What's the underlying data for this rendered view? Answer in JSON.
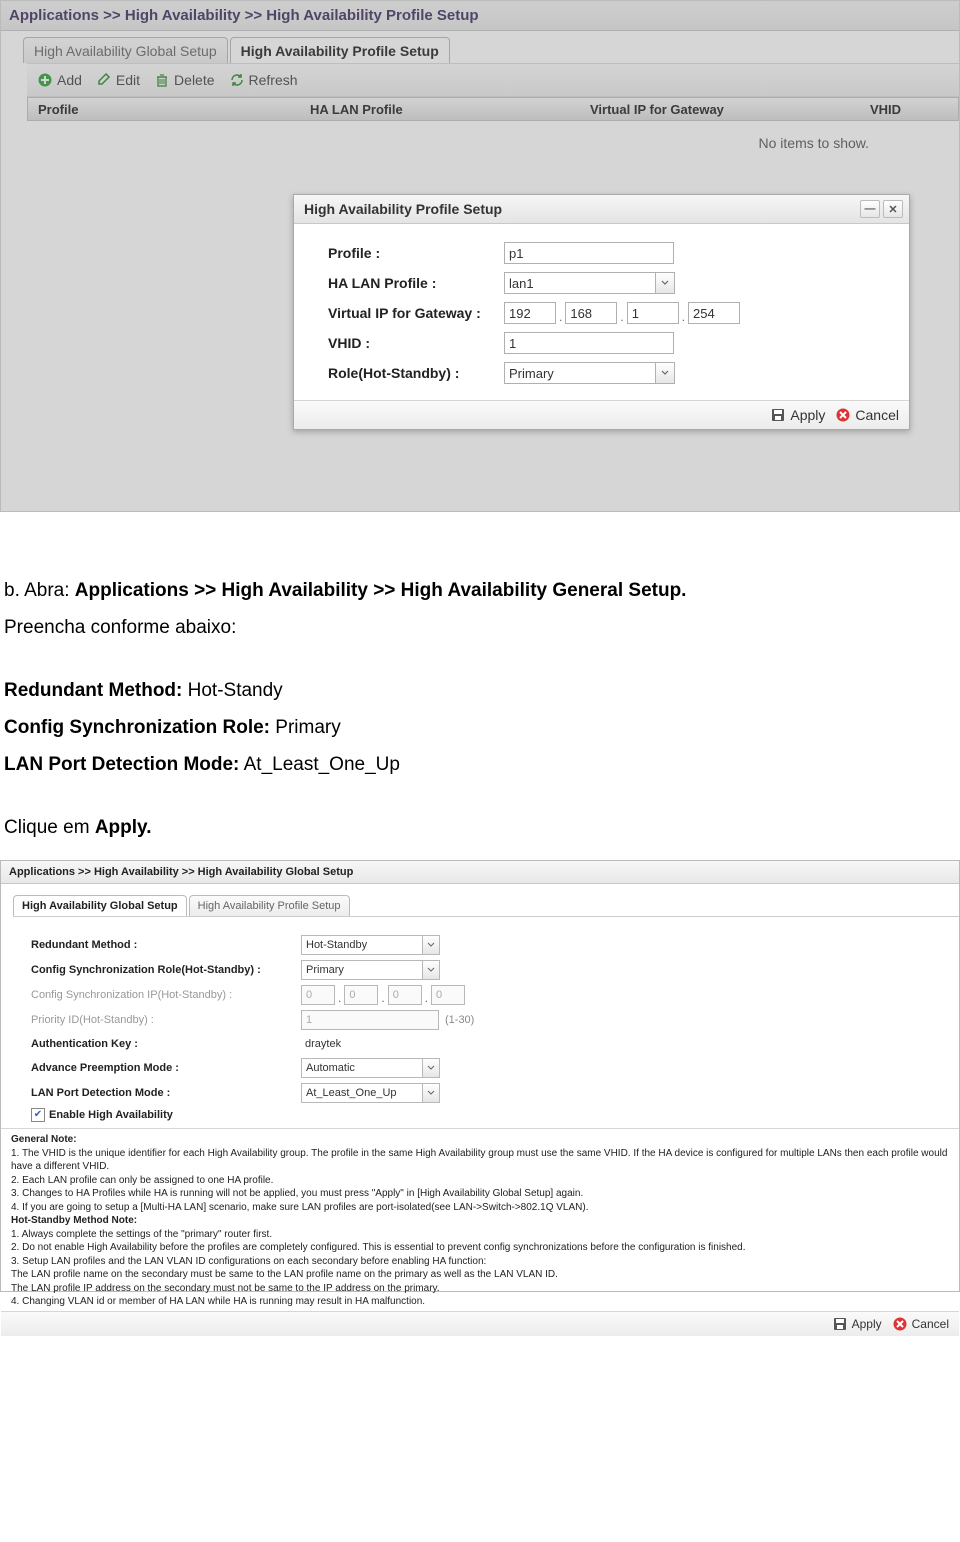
{
  "shot1": {
    "breadcrumb": "Applications >> High Availability >> High Availability Profile Setup",
    "tabs": {
      "t0": "High Availability Global Setup",
      "t1": "High Availability Profile Setup"
    },
    "toolbar": {
      "add": "Add",
      "edit": "Edit",
      "delete": "Delete",
      "refresh": "Refresh"
    },
    "thead": {
      "c0": "Profile",
      "c1": "HA LAN Profile",
      "c2": "Virtual IP for Gateway",
      "c3": "VHID"
    },
    "empty": "No items to show.",
    "dialog": {
      "title": "High Availability Profile Setup",
      "labels": {
        "profile": "Profile :",
        "halan": "HA LAN Profile :",
        "vip": "Virtual IP for Gateway :",
        "vhid": "VHID :",
        "role": "Role(Hot-Standby) :"
      },
      "values": {
        "profile": "p1",
        "halan": "lan1",
        "ip0": "192",
        "ip1": "168",
        "ip2": "1",
        "ip3": "254",
        "vhid": "1",
        "role": "Primary"
      },
      "buttons": {
        "apply": "Apply",
        "cancel": "Cancel"
      }
    }
  },
  "instr": {
    "l1a": "b. Abra: ",
    "l1b": "Applications >> High Availability >> High Availability General Setup.",
    "l2": "Preencha conforme abaixo:",
    "l3a": "Redundant Method:",
    "l3b": " Hot-Standy",
    "l4a": "Config Synchronization Role:",
    "l4b": " Primary",
    "l5a": "LAN Port Detection Mode:",
    "l5b": " At_Least_One_Up",
    "l6a": "Clique em ",
    "l6b": "Apply."
  },
  "shot2": {
    "breadcrumb": "Applications >> High Availability >> High Availability Global Setup",
    "tabs": {
      "t0": "High Availability Global Setup",
      "t1": "High Availability Profile Setup"
    },
    "labels": {
      "method": "Redundant Method :",
      "role": "Config Synchronization Role(Hot-Standby) :",
      "ip": "Config Synchronization IP(Hot-Standby) :",
      "pri": "Priority ID(Hot-Standby) :",
      "auth": "Authentication Key :",
      "pre": "Advance Preemption Mode :",
      "det": "LAN Port Detection Mode :",
      "en": "Enable High Availability"
    },
    "values": {
      "method": "Hot-Standby",
      "role": "Primary",
      "ip0": "0",
      "ip1": "0",
      "ip2": "0",
      "ip3": "0",
      "pri": "1",
      "pri_hint": "(1-30)",
      "auth": "draytek",
      "pre": "Automatic",
      "det": "At_Least_One_Up"
    },
    "notes": {
      "gn_title": "General Note:",
      "g1": "1. The VHID is the unique identifier for each High Availability group. The profile in the same High Availability group must use the same VHID. If the HA device is configured for multiple LANs then each profile would have a different VHID.",
      "g2": "2. Each LAN profile can only be assigned to one HA profile.",
      "g3": "3. Changes to HA Profiles while HA is running will not be applied, you must press \"Apply\" in [High Availability Global Setup] again.",
      "g4": "4. If you are going to setup a [Multi-HA LAN] scenario, make sure LAN profiles are port-isolated(see LAN->Switch->802.1Q VLAN).",
      "hs_title": "Hot-Standby Method Note:",
      "h1": "1. Always complete the settings of the \"primary\" router first.",
      "h2": "2. Do not enable High Availability before the profiles are completely configured. This is essential to prevent config synchronizations before the configuration is finished.",
      "h3": "3. Setup LAN profiles and the LAN VLAN ID configurations on each secondary before enabling HA function:",
      "h3a": "The LAN profile name on the secondary must be same to the LAN profile name on the primary as well as the LAN VLAN ID.",
      "h3b": "The LAN profile IP address on the secondary must not be same to the IP address on the primary.",
      "h4": "4. Changing VLAN id or member of HA LAN while HA is running may result in HA malfunction."
    },
    "buttons": {
      "apply": "Apply",
      "cancel": "Cancel"
    }
  }
}
